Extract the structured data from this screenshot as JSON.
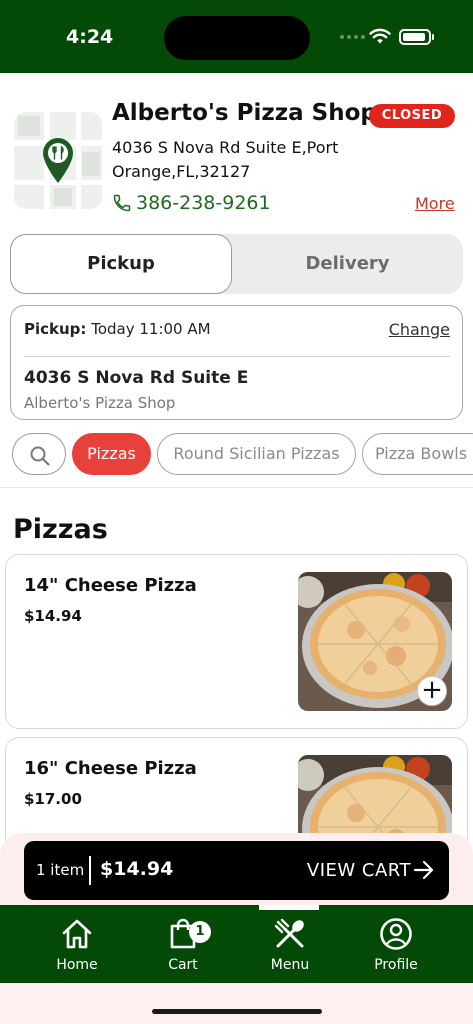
{
  "status_bar": {
    "time": "4:24"
  },
  "store": {
    "name": "Alberto's Pizza Shop",
    "status": "CLOSED",
    "address": "4036 S Nova Rd Suite E,Port Orange,FL,32127",
    "phone": "386-238-9261",
    "more_label": "More"
  },
  "mode_tabs": {
    "pickup": "Pickup",
    "delivery": "Delivery",
    "selected": "Pickup"
  },
  "pickup_card": {
    "label": "Pickup:",
    "time": "Today 11:00 AM",
    "change_label": "Change",
    "address": "4036 S Nova Rd Suite E",
    "store": "Alberto's Pizza Shop"
  },
  "categories": [
    "Pizzas",
    "Round Sicilian Pizzas",
    "Pizza Bowls"
  ],
  "active_category": "Pizzas",
  "section_title": "Pizzas",
  "products": [
    {
      "name": "14\" Cheese Pizza",
      "price": "$14.94"
    },
    {
      "name": "16\" Cheese Pizza",
      "price": "$17.00"
    }
  ],
  "cart": {
    "count_label": "1 item",
    "total": "$14.94",
    "view_label": "VIEW CART"
  },
  "nav": {
    "home": "Home",
    "cart": "Cart",
    "cart_badge": "1",
    "menu": "Menu",
    "profile": "Profile"
  },
  "colors": {
    "brand_green": "#034a06",
    "closed_red": "#e1251b",
    "active_chip": "#e8413c",
    "phone_green": "#1f6a22",
    "more_link": "#c6342a"
  }
}
